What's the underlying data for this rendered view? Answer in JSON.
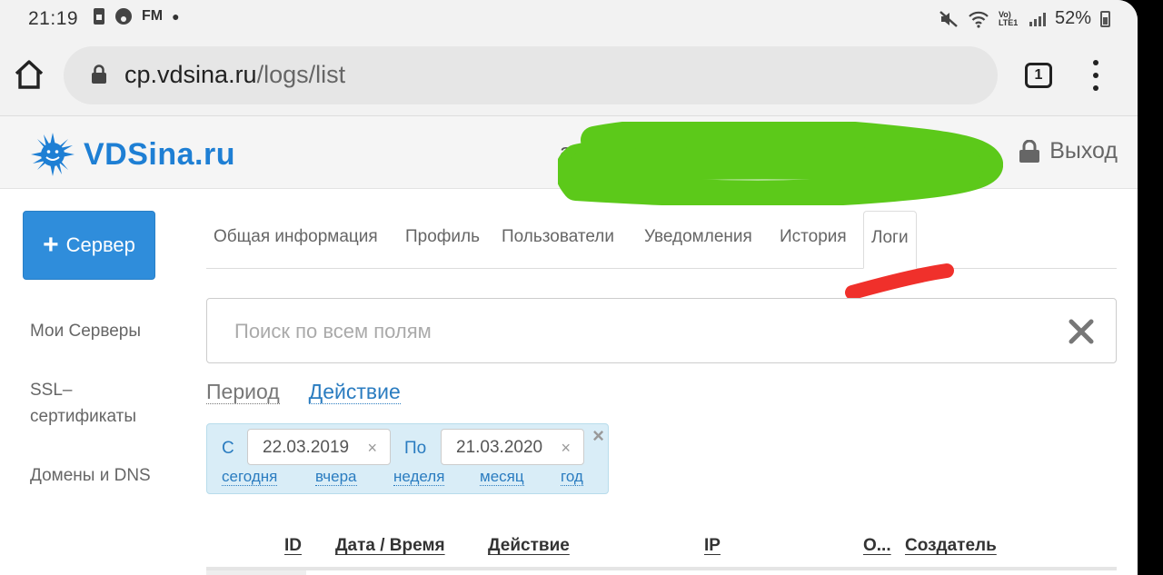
{
  "status_bar": {
    "time": "21:19",
    "left_icons": [
      "sim-icon",
      "record-icon",
      "fm-icon",
      "dot-icon"
    ],
    "fm_label": "FM",
    "lte_label": "Vo) LTE1",
    "battery": "52%"
  },
  "browser": {
    "url_host": "cp.vdsina.ru",
    "url_path": "/logs/list",
    "tab_count": "1"
  },
  "site": {
    "logo_text": "VDSina.ru",
    "user_initial": "a",
    "logout_label": "Выход"
  },
  "sidebar": {
    "add_server_label": "Сервер",
    "items": [
      {
        "label": "Мои Серверы"
      },
      {
        "label": "SSL–сертификаты"
      },
      {
        "label": "Домены и DNS"
      }
    ]
  },
  "tabs": [
    {
      "label": "Общая информация"
    },
    {
      "label": "Профиль"
    },
    {
      "label": "Пользователи"
    },
    {
      "label": "Уведомления"
    },
    {
      "label": "История"
    },
    {
      "label": "Логи",
      "active": true
    }
  ],
  "search": {
    "placeholder": "Поиск по всем полям",
    "value": ""
  },
  "filters": {
    "period_label": "Период",
    "action_label": "Действие"
  },
  "period": {
    "from_label": "С",
    "from_value": "22.03.2019",
    "to_label": "По",
    "to_value": "21.03.2020",
    "clear_glyph": "×",
    "quick": [
      "сегодня",
      "вчера",
      "неделя",
      "месяц",
      "год"
    ]
  },
  "table": {
    "columns": [
      "ID",
      "Дата / Время",
      "Действие",
      "IP",
      "О...",
      "Создатель"
    ]
  },
  "colors": {
    "brand": "#1e7fd4",
    "button": "#2f8ddb",
    "panel": "#d9edf7",
    "redaction": "#5cc91a",
    "highlight": "#f0302b"
  }
}
